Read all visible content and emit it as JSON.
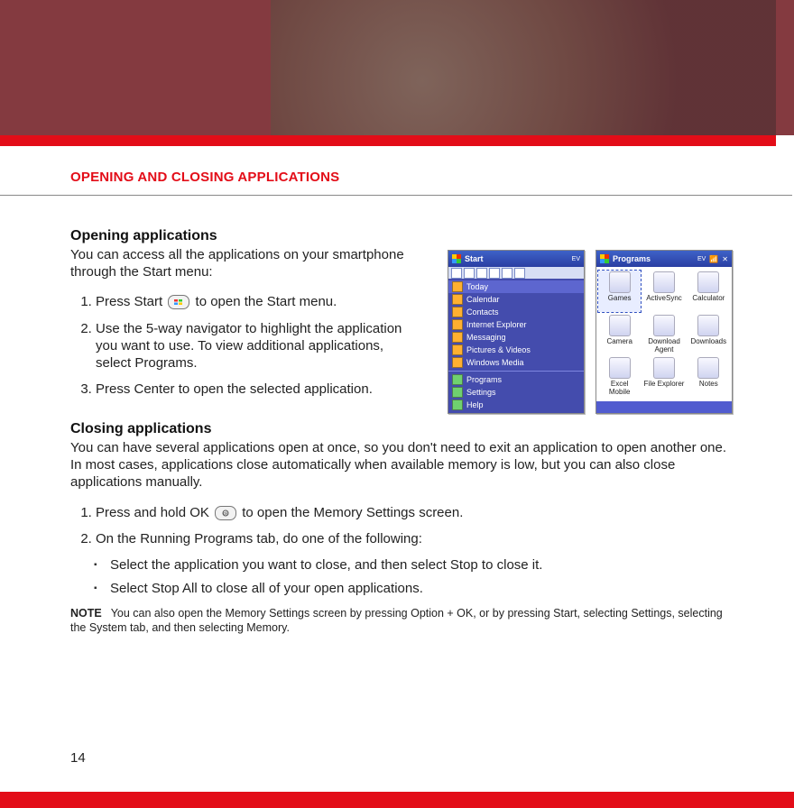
{
  "page_number": "14",
  "section_title": "OPENING AND CLOSING APPLICATIONS",
  "opening": {
    "heading": "Opening applications",
    "intro": "You can access all the applications on your smartphone through the Start menu:",
    "step1_a": "Press Start",
    "step1_b": "to open the Start menu.",
    "step2": "Use the 5-way navigator to highlight the application you want to use. To view additional applications, select Programs.",
    "step3": "Press Center to open the selected application."
  },
  "closing": {
    "heading": "Closing applications",
    "intro": "You can have several applications open at once, so you don't need to exit an application to open another one. In most cases, applications close automatically when available memory is low, but you can also close applications manually.",
    "step1_a": "Press and hold OK",
    "step1_b": "to open the Memory Settings screen.",
    "step2": "On the Running Programs tab, do one of the following:",
    "bullet1": "Select the application you want to close, and then select Stop to close it.",
    "bullet2": "Select Stop All to close all of your open applications."
  },
  "note": {
    "label": "NOTE",
    "text": "You can also open the Memory Settings screen by pressing Option + OK, or by pressing Start, selecting Settings, selecting the System tab, and then selecting Memory."
  },
  "device_left": {
    "title": "Start",
    "badge": "EV",
    "items": [
      "Today",
      "Calendar",
      "Contacts",
      "Internet Explorer",
      "Messaging",
      "Pictures & Videos",
      "Windows Media"
    ],
    "items2": [
      "Programs",
      "Settings",
      "Help"
    ]
  },
  "device_right": {
    "title": "Programs",
    "badge": "EV",
    "apps": [
      "Games",
      "ActiveSync",
      "Calculator",
      "Camera",
      "Download Agent",
      "Downloads",
      "Excel Mobile",
      "File Explorer",
      "Notes"
    ]
  }
}
